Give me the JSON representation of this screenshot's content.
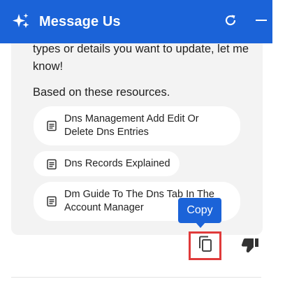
{
  "header": {
    "title": "Message Us",
    "background": "#1b63d8"
  },
  "message": {
    "text": "types or details you want to update, let me know!",
    "resources_heading": "Based on these resources."
  },
  "resources": [
    {
      "label": "Dns Management Add Edit Or Delete Dns Entries"
    },
    {
      "label": "Dns Records Explained"
    },
    {
      "label": "Dm Guide To The Dns Tab In The Account Manager"
    }
  ],
  "tooltip": {
    "label": "Copy"
  },
  "icons": {
    "sparkle": "sparkle-icon",
    "refresh": "refresh-icon",
    "minimize": "minimize-icon",
    "document": "document-icon",
    "copy": "copy-icon",
    "thumbs_down": "thumbs-down-icon"
  },
  "colors": {
    "accent": "#1b63d8",
    "highlight": "#e03a3a",
    "bubble": "#f3f3f3"
  }
}
